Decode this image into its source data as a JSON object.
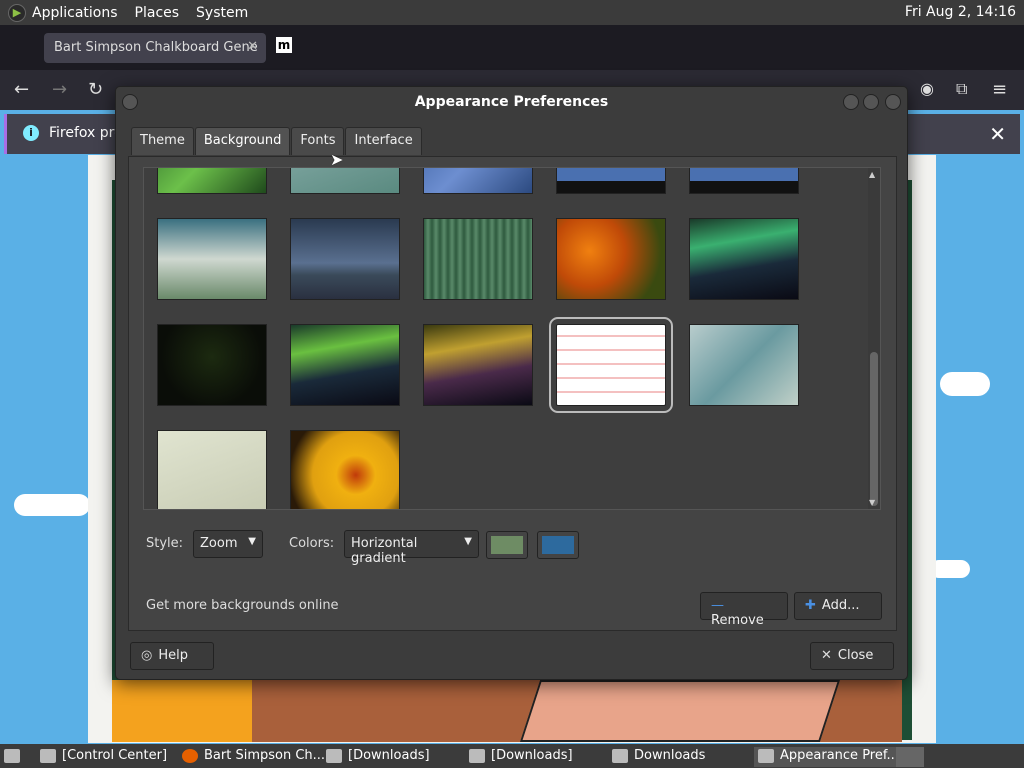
{
  "topbar": {
    "menus": [
      "Applications",
      "Places",
      "System"
    ],
    "clock": "Fri Aug 2, 14:16"
  },
  "firefox": {
    "tab_title": "Bart Simpson Chalkboard Gene",
    "notice": "Firefox preve"
  },
  "dialog": {
    "title": "Appearance Preferences",
    "tabs": [
      "Theme",
      "Background",
      "Fonts",
      "Interface"
    ],
    "active_tab": "Background",
    "style_label": "Style:",
    "style_value": "Zoom",
    "colors_label": "Colors:",
    "colors_value": "Horizontal gradient",
    "color1": "#6e8c64",
    "color2": "#2d6a9e",
    "more_link": "Get more backgrounds online",
    "remove_label": "Remove",
    "add_label": "Add...",
    "help_label": "Help",
    "close_label": "Close"
  },
  "taskbar": {
    "items": [
      "[Control Center]",
      "Bart Simpson Ch...",
      "[Downloads]",
      "[Downloads]",
      "Downloads",
      "Appearance Pref..."
    ]
  }
}
